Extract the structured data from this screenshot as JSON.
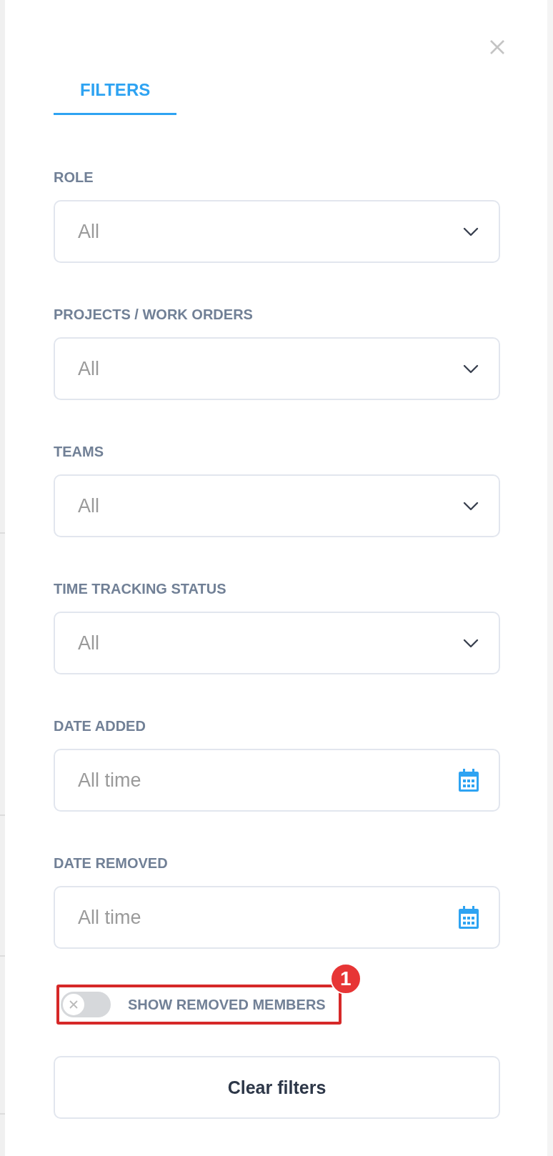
{
  "tabs": [
    {
      "label": "FILTERS",
      "selected": true
    }
  ],
  "filters": [
    {
      "label": "ROLE",
      "kind": "select",
      "value": "All"
    },
    {
      "label": "PROJECTS / WORK ORDERS",
      "kind": "select",
      "value": "All"
    },
    {
      "label": "TEAMS",
      "kind": "select",
      "value": "All"
    },
    {
      "label": "TIME TRACKING STATUS",
      "kind": "select",
      "value": "All"
    },
    {
      "label": "DATE ADDED",
      "kind": "date",
      "value": "All time"
    },
    {
      "label": "DATE REMOVED",
      "kind": "date",
      "value": "All time"
    }
  ],
  "show_removed": {
    "label": "SHOW REMOVED MEMBERS",
    "on": false,
    "annotation": "1"
  },
  "clear_button": "Clear filters"
}
